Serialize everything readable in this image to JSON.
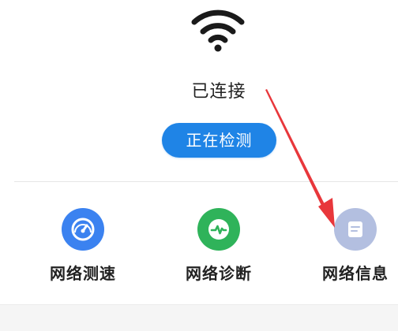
{
  "status": {
    "connection_text": "已连接",
    "detect_button_label": "正在检测"
  },
  "tools": [
    {
      "label": "网络测速",
      "icon": "speedometer-icon",
      "color": "#3b82f0"
    },
    {
      "label": "网络诊断",
      "icon": "pulse-icon",
      "color": "#2fb35a"
    },
    {
      "label": "网络信息",
      "icon": "document-icon",
      "color": "#b3bfe0"
    }
  ],
  "colors": {
    "accent": "#1f84e6",
    "annotation_arrow": "#e8373b"
  }
}
